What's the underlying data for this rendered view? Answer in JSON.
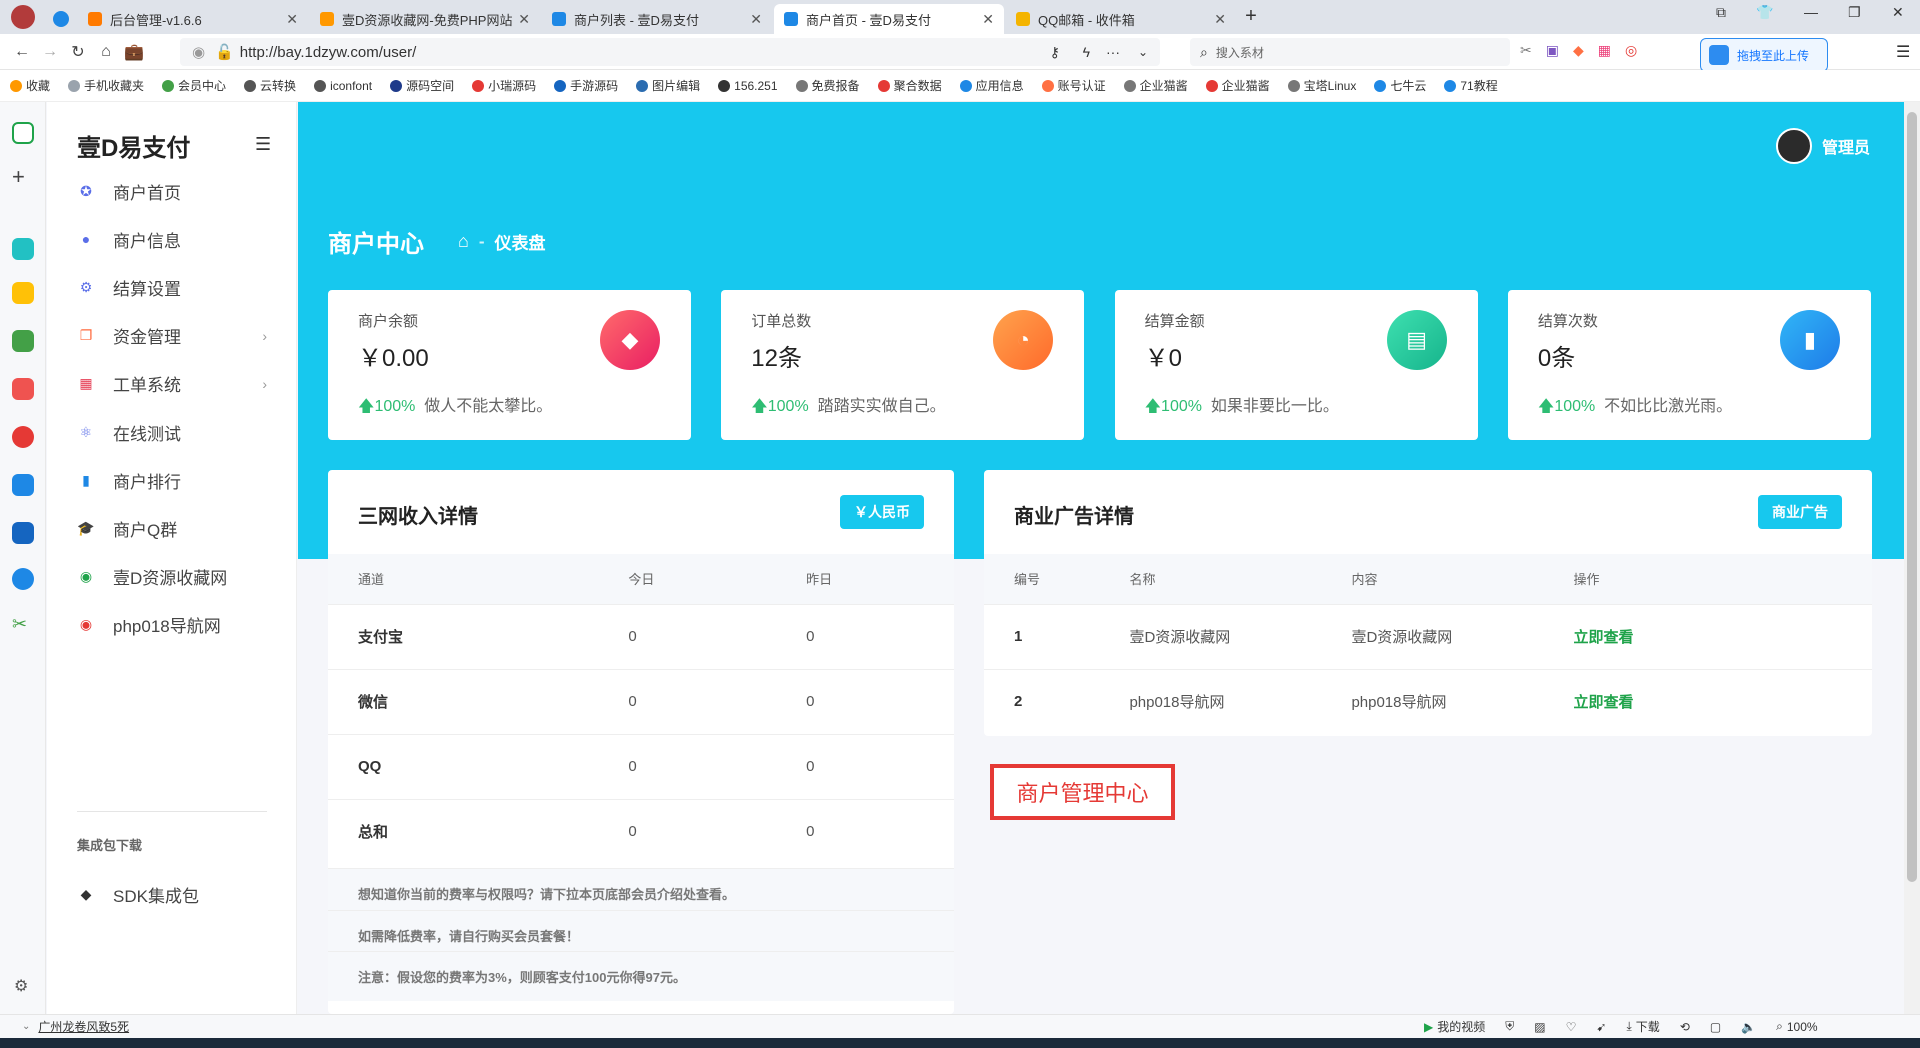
{
  "browser": {
    "tabs": [
      {
        "title": "后台管理-v1.6.6",
        "color": "#ff7a00",
        "active": false
      },
      {
        "title": "壹D资源收藏网-免费PHP网站",
        "color": "#ff9800",
        "active": false
      },
      {
        "title": "商户列表 - 壹D易支付",
        "color": "#1e88e5",
        "active": false
      },
      {
        "title": "商户首页 - 壹D易支付",
        "color": "#1e88e5",
        "active": true
      },
      {
        "title": "QQ邮箱 - 收件箱",
        "color": "#f4b400",
        "active": false
      }
    ],
    "url": "http://bay.1dzyw.com/user/",
    "search_placeholder": "搜入系材",
    "upload_label": "拖拽至此上传",
    "bookmarks": [
      "收藏",
      "手机收藏夹",
      "会员中心",
      "云转换",
      "iconfont",
      "源码空间",
      "小瑞源码",
      "手游源码",
      "图片编辑",
      "156.251",
      "免费报备",
      "聚合数据",
      "应用信息",
      "账号认证",
      "企业猫酱",
      "企业猫酱",
      "宝塔Linux",
      "七牛云",
      "71教程"
    ],
    "status_left": "广州龙卷风致5死",
    "status_right": [
      "我的视频",
      "下载",
      "100%"
    ]
  },
  "sidebar": {
    "brand": "壹D易支付",
    "items": [
      {
        "label": "商户首页",
        "icon": "compass-icon",
        "color": "#5a6ee8",
        "arrow": false
      },
      {
        "label": "商户信息",
        "icon": "user-icon",
        "color": "#5a6ee8",
        "arrow": false
      },
      {
        "label": "结算设置",
        "icon": "gear-icon",
        "color": "#5a6ee8",
        "arrow": false
      },
      {
        "label": "资金管理",
        "icon": "copy-icon",
        "color": "#ff6a3d",
        "arrow": true
      },
      {
        "label": "工单系统",
        "icon": "calendar-icon",
        "color": "#e53950",
        "arrow": true
      },
      {
        "label": "在线测试",
        "icon": "atom-icon",
        "color": "#5a6ee8",
        "arrow": false
      },
      {
        "label": "商户排行",
        "icon": "bar-chart-icon",
        "color": "#1e88e5",
        "arrow": false
      },
      {
        "label": "商户Q群",
        "icon": "graduation-cap-icon",
        "color": "#222",
        "arrow": false
      },
      {
        "label": "壹D资源收藏网",
        "icon": "globe-icon",
        "color": "#1fa34a",
        "arrow": false
      },
      {
        "label": "php018导航网",
        "icon": "globe-icon",
        "color": "#e53935",
        "arrow": false
      }
    ],
    "group_label": "集成包下载",
    "sdk_label": "SDK集成包"
  },
  "header": {
    "user": "管理员",
    "title": "商户中心",
    "breadcrumb": "仪表盘"
  },
  "cards": [
    {
      "label": "商户余额",
      "value": "￥0.00",
      "pct": "100%",
      "note": "做人不能太攀比。",
      "icon": "diamond-icon",
      "grad": "linear-gradient(135deg,#ff6b6b,#e91e63)"
    },
    {
      "label": "订单总数",
      "value": "12条",
      "pct": "100%",
      "note": "踏踏实实做自己。",
      "icon": "pie-chart-icon",
      "grad": "linear-gradient(135deg,#ffa34d,#ff6a2b)"
    },
    {
      "label": "结算金额",
      "value": "￥0",
      "pct": "100%",
      "note": "如果非要比一比。",
      "icon": "money-icon",
      "grad": "linear-gradient(135deg,#3ee0b0,#16b48c)"
    },
    {
      "label": "结算次数",
      "value": "0条",
      "pct": "100%",
      "note": "不如比比激光雨。",
      "icon": "bar-chart-icon",
      "grad": "linear-gradient(135deg,#31b6f7,#1e7be8)"
    }
  ],
  "income": {
    "title": "三网收入详情",
    "button": "￥人民币",
    "headers": [
      "通道",
      "今日",
      "昨日"
    ],
    "rows": [
      [
        "支付宝",
        "0",
        "0"
      ],
      [
        "微信",
        "0",
        "0"
      ],
      [
        "QQ",
        "0",
        "0"
      ],
      [
        "总和",
        "0",
        "0"
      ]
    ],
    "notes": [
      "想知道你当前的费率与权限吗？请下拉本页底部会员介绍处查看。",
      "如需降低费率，请自行购买会员套餐！",
      "注意：假设您的费率为3%，则顾客支付100元你得97元。"
    ]
  },
  "ads": {
    "title": "商业广告详情",
    "button": "商业广告",
    "headers": [
      "编号",
      "名称",
      "内容",
      "操作"
    ],
    "rows": [
      [
        "1",
        "壹D资源收藏网",
        "壹D资源收藏网",
        "立即查看"
      ],
      [
        "2",
        "php018导航网",
        "php018导航网",
        "立即查看"
      ]
    ]
  },
  "highlight": "商户管理中心"
}
